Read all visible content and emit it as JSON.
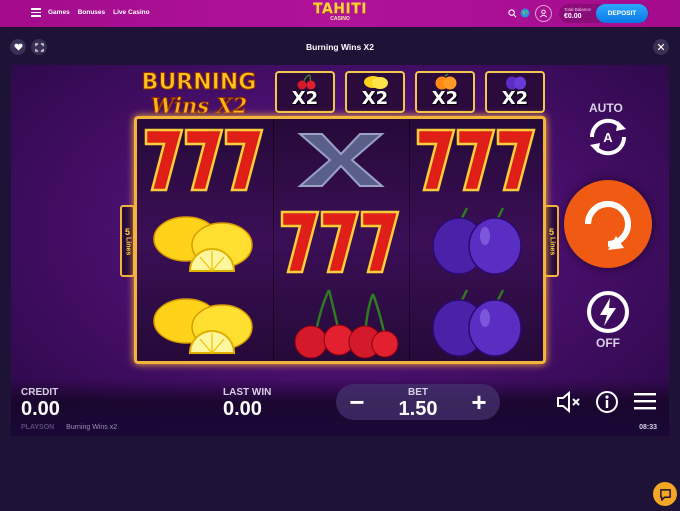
{
  "site": {
    "nav": [
      "Games",
      "Bonuses",
      "Live Casino"
    ],
    "logo_main": "TAHITI",
    "logo_sub": "CASINO",
    "balance_label": "Total Balance",
    "balance_value": "€0.00",
    "deposit_label": "DEPOSIT"
  },
  "game": {
    "title": "Burning Wins X2",
    "logo_line1": "BURNING",
    "logo_line2": "Wins X2",
    "multiplier_badges": [
      {
        "fruit": "cherry",
        "label": "X2"
      },
      {
        "fruit": "lemon",
        "label": "X2"
      },
      {
        "fruit": "orange",
        "label": "X2"
      },
      {
        "fruit": "plum",
        "label": "X2"
      }
    ],
    "reels": [
      [
        "seven",
        "seven",
        "lemon"
      ],
      [
        "x",
        "seven",
        "cherry"
      ],
      [
        "seven",
        "plum",
        "plum"
      ]
    ],
    "lines_count": "5",
    "lines_word": "Lines",
    "auto_label": "AUTO",
    "turbo_label": "OFF",
    "credit_label": "CREDIT",
    "credit_value": "0.00",
    "lastwin_label": "LAST WIN",
    "lastwin_value": "0.00",
    "bet_label": "BET",
    "bet_value": "1.50",
    "bet_minus": "−",
    "bet_plus": "+",
    "provider": "PLAYSON",
    "game_name_footer": "Burning Wins x2",
    "clock": "08:33"
  },
  "colors": {
    "topbar": "#a30c8c",
    "deposit": "#0b78e6",
    "spin_button": "#f05a12",
    "frame_gold": "#f2b43a",
    "chat_button": "#f5a623"
  },
  "icons": [
    "menu-icon",
    "search-icon",
    "globe-icon",
    "user-icon",
    "heart-icon",
    "fullscreen-icon",
    "close-icon",
    "auto-spin-icon",
    "spin-icon",
    "turbo-icon",
    "sound-off-icon",
    "info-icon",
    "hamburger-icon",
    "chat-icon"
  ]
}
